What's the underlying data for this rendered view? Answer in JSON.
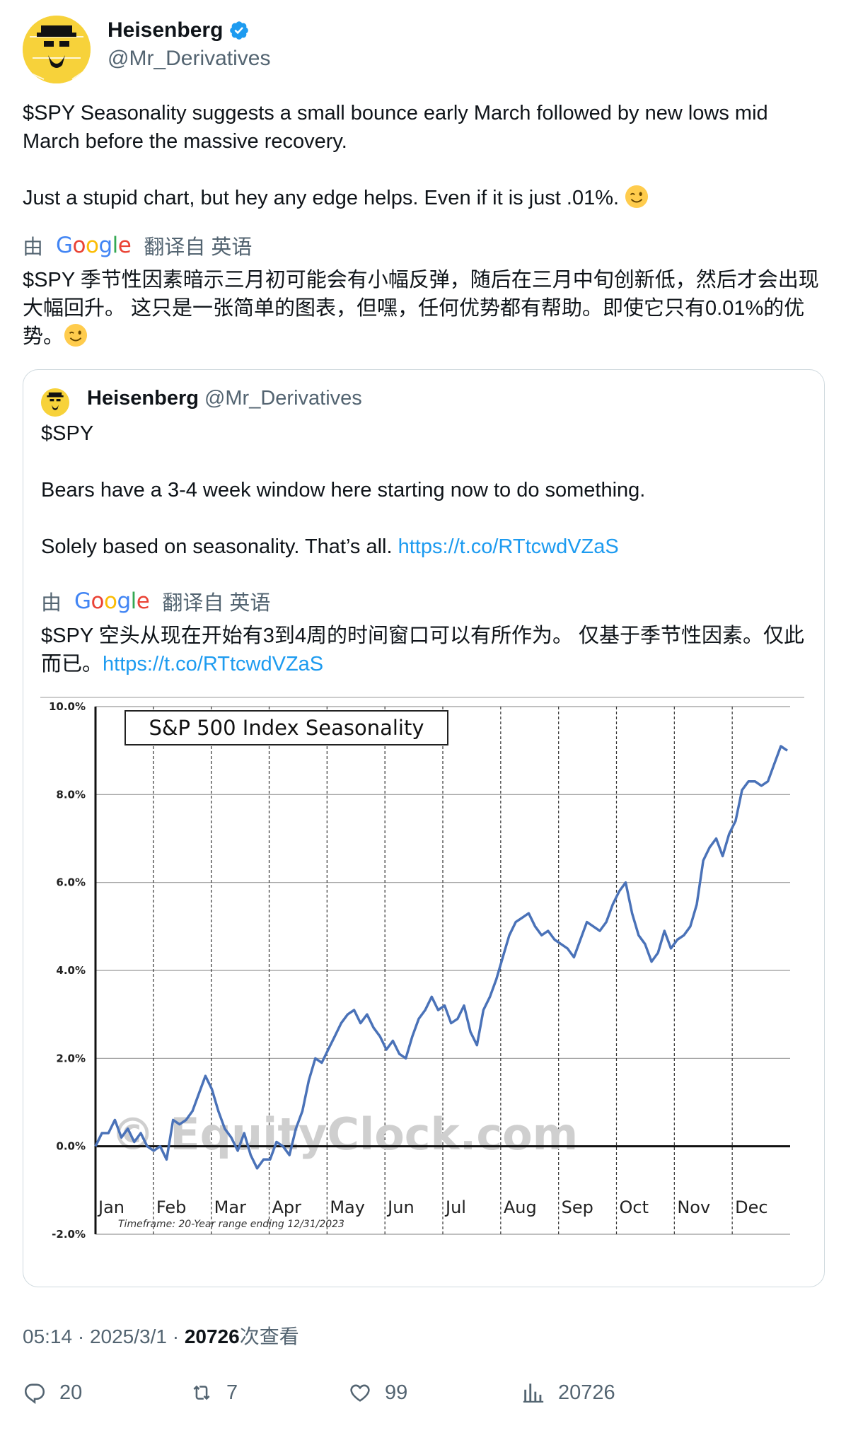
{
  "tweet": {
    "author": {
      "display_name": "Heisenberg",
      "handle": "@Mr_Derivatives"
    },
    "text": "$SPY Seasonality suggests a small bounce early March followed by new lows mid March before the massive recovery.\n\nJust a stupid chart, but hey any edge helps. Even if it is just .01%.",
    "translate_prefix": "由",
    "translate_brand": "Google",
    "translate_suffix": "翻译自 英语",
    "translated_text": "$SPY 季节性因素暗示三月初可能会有小幅反弹，随后在三月中旬创新低，然后才会出现大幅回升。 这只是一张简单的图表，但嘿，任何优势都有帮助。即使它只有0.01%的优势。",
    "timestamp": "05:14 · 2025/3/1 · ",
    "views_count": "20726",
    "views_label": "次查看",
    "stats": {
      "replies": "20",
      "retweets": "7",
      "likes": "99",
      "views": "20726"
    }
  },
  "quoted": {
    "author": {
      "display_name": "Heisenberg",
      "handle": "@Mr_Derivatives"
    },
    "text": "$SPY\n\nBears have a 3-4 week window here starting now to do something.\n\nSolely based on seasonality. That’s all. ",
    "link": "https://t.co/RTtcwdVZaS",
    "translate_prefix": "由",
    "translate_brand": "Google",
    "translate_suffix": "翻译自 英语",
    "translated_text": "$SPY 空头从现在开始有3到4周的时间窗口可以有所作为。 仅基于季节性因素。仅此而已。",
    "translated_link": "https://t.co/RTtcwdVZaS"
  },
  "chart_data": {
    "type": "line",
    "title": "S&P 500 Index Seasonality",
    "watermark": "© EquityClock.com",
    "footnote": "Timeframe: 20-Year range ending 12/31/2023",
    "months": [
      "Jan",
      "Feb",
      "Mar",
      "Apr",
      "May",
      "Jun",
      "Jul",
      "Aug",
      "Sep",
      "Oct",
      "Nov",
      "Dec"
    ],
    "yticks": [
      "10.0%",
      "8.0%",
      "6.0%",
      "4.0%",
      "2.0%",
      "0.0%",
      "-2.0%"
    ],
    "ylim": [
      -2.0,
      10.0
    ],
    "grid": true,
    "line_color": "#4a72b8",
    "series": [
      {
        "values": [
          0.0,
          0.3,
          0.3,
          0.6,
          0.2,
          0.4,
          0.1,
          0.3,
          0.0,
          -0.1,
          0.0,
          -0.3,
          0.6,
          0.5,
          0.6,
          0.8,
          1.2,
          1.6,
          1.3,
          0.8,
          0.4,
          0.2,
          -0.1,
          0.3,
          -0.2,
          -0.5,
          -0.3,
          -0.3,
          0.1,
          0.0,
          -0.2,
          0.4,
          0.8,
          1.5,
          2.0,
          1.9,
          2.2,
          2.5,
          2.8,
          3.0,
          3.1,
          2.8,
          3.0,
          2.7,
          2.5,
          2.2,
          2.4,
          2.1,
          2.0,
          2.5,
          2.9,
          3.1,
          3.4,
          3.1,
          3.2,
          2.8,
          2.9,
          3.2,
          2.6,
          2.3,
          3.1,
          3.4,
          3.8,
          4.3,
          4.8,
          5.1,
          5.2,
          5.3,
          5.0,
          4.8,
          4.9,
          4.7,
          4.6,
          4.5,
          4.3,
          4.7,
          5.1,
          5.0,
          4.9,
          5.1,
          5.5,
          5.8,
          6.0,
          5.3,
          4.8,
          4.6,
          4.2,
          4.4,
          4.9,
          4.5,
          4.7,
          4.8,
          5.0,
          5.5,
          6.5,
          6.8,
          7.0,
          6.6,
          7.1,
          7.4,
          8.1,
          8.3,
          8.3,
          8.2,
          8.3,
          8.7,
          9.1,
          9.0
        ]
      }
    ]
  }
}
